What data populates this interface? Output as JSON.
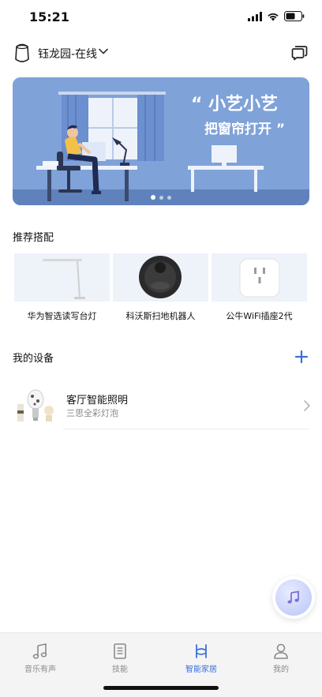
{
  "status_bar": {
    "time": "15:21"
  },
  "header": {
    "home_name": "钰龙园-在线"
  },
  "banner": {
    "line1": "“ 小艺小艺",
    "line2": "把窗帘打开 ”",
    "slide_count": 3,
    "active_slide": 1
  },
  "recommend": {
    "title": "推荐搭配",
    "items": [
      {
        "label": "华为智选读写台灯",
        "icon": "desk-lamp-image"
      },
      {
        "label": "科沃斯扫地机器人",
        "icon": "robot-vacuum-image"
      },
      {
        "label": "公牛WiFi插座2代",
        "icon": "smart-plug-image"
      }
    ]
  },
  "devices": {
    "title": "我的设备",
    "items": [
      {
        "name": "客厅智能照明",
        "sub": "三思全彩灯泡",
        "icon": "smart-bulb-image"
      }
    ]
  },
  "tabbar": {
    "items": [
      {
        "label": "音乐有声",
        "icon": "music-note-icon",
        "active": false
      },
      {
        "label": "技能",
        "icon": "book-icon",
        "active": false
      },
      {
        "label": "智能家居",
        "icon": "smart-home-icon",
        "active": true
      },
      {
        "label": "我的",
        "icon": "person-icon",
        "active": false
      }
    ]
  },
  "colors": {
    "accent": "#3b6fd8",
    "banner_bg": "#7fa2d8",
    "card_bg": "#eef3fa"
  }
}
